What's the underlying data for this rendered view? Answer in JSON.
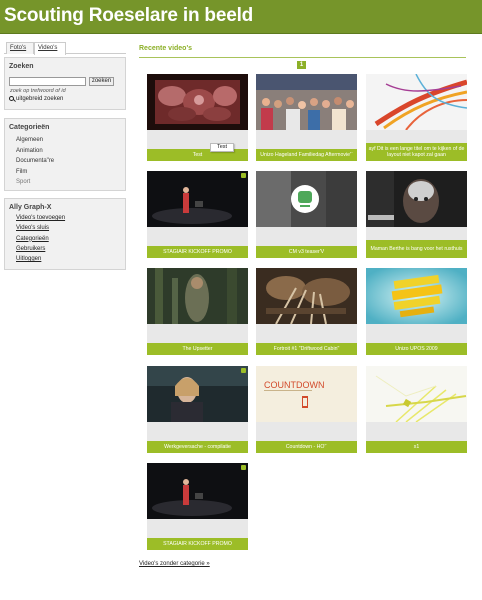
{
  "header": {
    "title": "Scouting Roeselare in beeld"
  },
  "sidebar": {
    "tabs": [
      {
        "label": "Foto's"
      },
      {
        "label": "Video's"
      }
    ],
    "search": {
      "heading": "Zoeken",
      "input_value": "",
      "button_label": "zoeken",
      "hint": "zoek op trefwoord of id",
      "advanced_label": "uitgebreid zoeken"
    },
    "categories": {
      "heading": "Categorieën",
      "items": [
        "Algemeen",
        "Animation",
        "Documenta\"re",
        "Film",
        "Sport"
      ]
    },
    "user": {
      "heading": "Ally Graph-X",
      "items": [
        "Video's toevoegen",
        "Video's sluis",
        "Categorieën",
        "Gebruikers",
        "Uitloggen"
      ]
    }
  },
  "main": {
    "section_title": "Recente video's",
    "page_number": "1",
    "tooltip": "Test",
    "more_link": "Video's zonder categorie »",
    "videos": [
      {
        "title": "Test"
      },
      {
        "title": "Unizo Hageland Familiedag Aftermovie'¨"
      },
      {
        "title": "ayf Dit is een lange titel om te kijken of de layout niet kapot zal gaan"
      },
      {
        "title": "STAGIAIR KICKOFF PROMO"
      },
      {
        "title": "CM v3 teaser'V"
      },
      {
        "title": "Maman Berthe is bang voor het rusthuis"
      },
      {
        "title": "The Upsetter"
      },
      {
        "title": "Fortroit #1 \"Driftwood Cabin\""
      },
      {
        "title": "Unizo UPOS 2009"
      },
      {
        "title": "Werkgeversache - compilatie"
      },
      {
        "title": "Countdown - HO'¨"
      },
      {
        "title": "x1"
      },
      {
        "title": "STAGIAIR KICKOFF PROMO"
      }
    ]
  },
  "colors": {
    "header": "#76952a",
    "accent": "#9cbd27",
    "title_green": "#8cb028"
  }
}
